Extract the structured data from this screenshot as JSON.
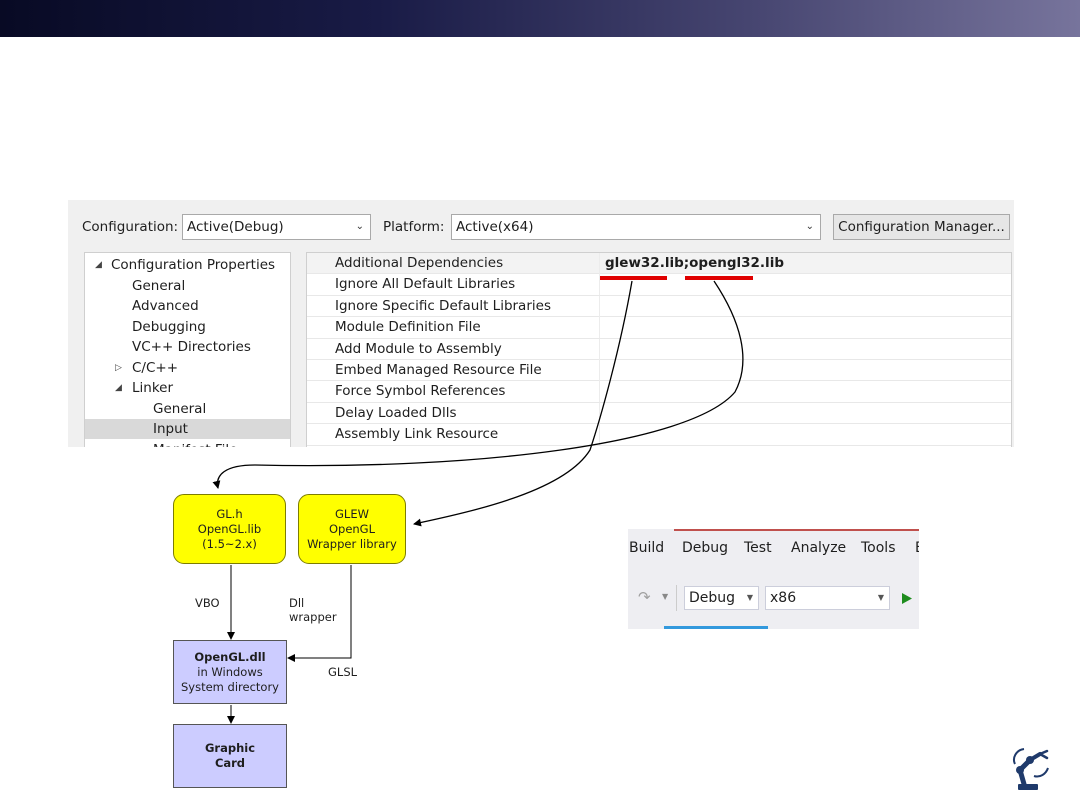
{
  "config": {
    "configuration_label": "Configuration:",
    "configuration_value": "Active(Debug)",
    "platform_label": "Platform:",
    "platform_value": "Active(x64)",
    "manager_button": "Configuration Manager..."
  },
  "tree": {
    "items": [
      {
        "label": "Configuration Properties",
        "arrow": "◢"
      },
      {
        "label": "General"
      },
      {
        "label": "Advanced"
      },
      {
        "label": "Debugging"
      },
      {
        "label": "VC++ Directories"
      },
      {
        "label": "C/C++",
        "arrow": "▷"
      },
      {
        "label": "Linker",
        "arrow": "◢"
      },
      {
        "label": "General"
      },
      {
        "label": "Input"
      },
      {
        "label": "Manifest File"
      }
    ],
    "selected_index": 8
  },
  "properties": {
    "rows": [
      {
        "name": "Additional Dependencies",
        "value": "glew32.lib;opengl32.lib"
      },
      {
        "name": "Ignore All Default Libraries",
        "value": ""
      },
      {
        "name": "Ignore Specific Default Libraries",
        "value": ""
      },
      {
        "name": "Module Definition File",
        "value": ""
      },
      {
        "name": "Add Module to Assembly",
        "value": ""
      },
      {
        "name": "Embed Managed Resource File",
        "value": ""
      },
      {
        "name": "Force Symbol References",
        "value": ""
      },
      {
        "name": "Delay Loaded Dlls",
        "value": ""
      },
      {
        "name": "Assembly Link Resource",
        "value": ""
      }
    ]
  },
  "diagram": {
    "gl_node": [
      "GL.h",
      "OpenGL.lib",
      "(1.5~2.x)"
    ],
    "glew_node": [
      "GLEW",
      "OpenGL",
      "Wrapper library"
    ],
    "dll_node": [
      "OpenGL.dll",
      "in Windows",
      "System directory"
    ],
    "card_node": [
      "Graphic",
      "Card"
    ],
    "labels": {
      "vbo": "VBO",
      "dll_wrapper_1": "Dll",
      "dll_wrapper_2": "wrapper",
      "glsl": "GLSL"
    }
  },
  "vs_toolbar": {
    "menu": [
      "Build",
      "Debug",
      "Test",
      "Analyze",
      "Tools",
      "E"
    ],
    "config_value": "Debug",
    "platform_value": "x86",
    "icons": [
      "redo-icon",
      "dropdown-caret-icon",
      "start-debugging-icon"
    ]
  },
  "colors": {
    "underline_red": "#e00000",
    "yellow_node": "#ffff00",
    "purple_node": "#ccccff",
    "start_green": "#1e8c1e"
  },
  "logo": "robot-arm-logo"
}
